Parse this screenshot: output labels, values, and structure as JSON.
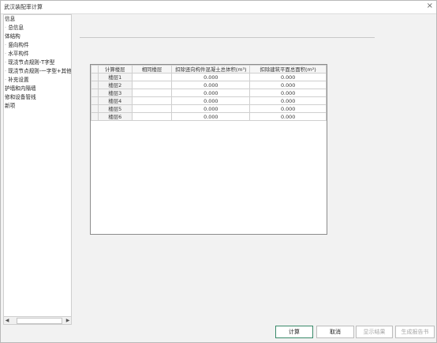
{
  "window": {
    "title": "武汉装配率计算",
    "close_symbol": "×"
  },
  "sidebar": {
    "items": [
      {
        "label": "信息"
      },
      {
        "label": "总信息"
      },
      {
        "label": "体结构"
      },
      {
        "label": "竖向构件"
      },
      {
        "label": "水平构件"
      },
      {
        "label": "现浇节点规则-T字型"
      },
      {
        "label": "现浇节点规则-一字型+其他"
      },
      {
        "label": "补充设置"
      },
      {
        "label": "护墙和内隔墙"
      },
      {
        "label": "修和设备管线"
      },
      {
        "label": "新项"
      }
    ],
    "scroll_left": "◀",
    "scroll_right": "▶"
  },
  "table": {
    "columns": [
      "计算楼层",
      "相同楼层",
      "扣除竖向构件混凝土总体积(m³)",
      "扣除建筑平面总面积(m²)"
    ],
    "rows": [
      {
        "floor": "楼层1",
        "same": "",
        "volume": "0.000",
        "area": "0.000"
      },
      {
        "floor": "楼层2",
        "same": "",
        "volume": "0.000",
        "area": "0.000"
      },
      {
        "floor": "楼层3",
        "same": "",
        "volume": "0.000",
        "area": "0.000"
      },
      {
        "floor": "楼层4",
        "same": "",
        "volume": "0.000",
        "area": "0.000"
      },
      {
        "floor": "楼层5",
        "same": "",
        "volume": "0.000",
        "area": "0.000"
      },
      {
        "floor": "楼层6",
        "same": "",
        "volume": "0.000",
        "area": "0.000"
      }
    ]
  },
  "footer": {
    "calculate": "计算",
    "cancel": "取消",
    "show_result": "显示结果",
    "generate_report": "生成报告书"
  }
}
